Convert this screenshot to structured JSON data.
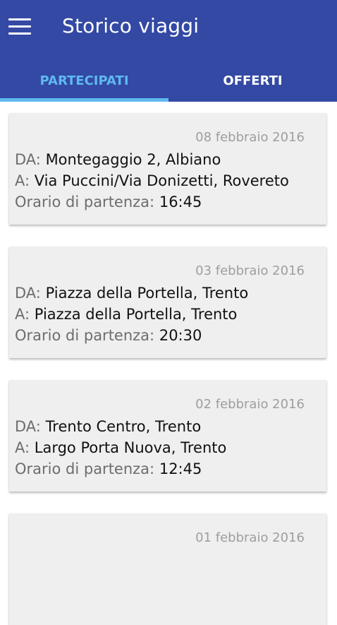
{
  "header": {
    "title": "Storico viaggi",
    "menu_icon": "hamburger-menu-icon"
  },
  "tabs": [
    {
      "label": "PARTECIPATI",
      "active": true
    },
    {
      "label": "OFFERTI",
      "active": false
    }
  ],
  "labels": {
    "from": "DA:",
    "to": "A:",
    "departure": "Orario di partenza:"
  },
  "trips": [
    {
      "date": "08 febbraio 2016",
      "from": "Montegaggio 2, Albiano",
      "to": "Via Puccini/Via Donizetti, Rovereto",
      "time": "16:45"
    },
    {
      "date": "03 febbraio 2016",
      "from": "Piazza della Portella, Trento",
      "to": "Piazza della Portella, Trento",
      "time": "20:30"
    },
    {
      "date": "02 febbraio 2016",
      "from": "Trento Centro, Trento",
      "to": "Largo Porta Nuova, Trento",
      "time": "12:45"
    },
    {
      "date": "01 febbraio 2016"
    }
  ],
  "colors": {
    "primary": "#3349a4",
    "accent": "#5fb8ef",
    "card_background": "#efefef"
  }
}
